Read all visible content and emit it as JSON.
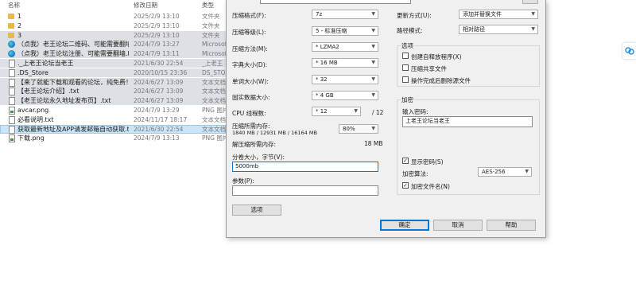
{
  "explorer": {
    "columns": {
      "name": "名称",
      "date": "修改日期",
      "type": "类型"
    },
    "files": [
      {
        "icon": "folder-icon",
        "name": "1",
        "date": "2025/2/9 13:10",
        "type": "文件夹"
      },
      {
        "icon": "folder-icon",
        "name": "2",
        "date": "2025/2/9 13:10",
        "type": "文件夹"
      },
      {
        "icon": "folder-icon",
        "name": "3",
        "date": "2025/2/9 13:10",
        "type": "文件夹"
      },
      {
        "icon": "edge-icon",
        "name": "（点我）老王论坛二维码、可能需要翻墙...",
        "date": "2024/7/9 13:27",
        "type": "Microsoft"
      },
      {
        "icon": "edge-icon",
        "name": "（点我）老王论坛注册、可能需要翻墙.h...",
        "date": "2024/7/9 13:11",
        "type": "Microsoft"
      },
      {
        "icon": "doc-icon",
        "name": "._上老王论坛当老王",
        "date": "2021/6/30 22:54",
        "type": "_上老王"
      },
      {
        "icon": "doc-icon",
        "name": ".DS_Store",
        "date": "2020/10/15 23:36",
        "type": "DS_STOR"
      },
      {
        "icon": "doc-icon",
        "name": "【来了就能下载和观看的论坛，纯免费！...",
        "date": "2024/6/27 13:09",
        "type": "文本文档"
      },
      {
        "icon": "doc-icon",
        "name": "【老王论坛介绍】.txt",
        "date": "2024/6/27 13:09",
        "type": "文本文档"
      },
      {
        "icon": "doc-icon",
        "name": "【老王论坛永久地址发布页】.txt",
        "date": "2024/6/27 13:09",
        "type": "文本文档"
      },
      {
        "icon": "png-icon",
        "name": "avcar.png",
        "date": "2024/7/9 13:29",
        "type": "PNG 图片"
      },
      {
        "icon": "doc-icon",
        "name": "必看说明.txt",
        "date": "2024/11/17 18:17",
        "type": "文本文档"
      },
      {
        "icon": "doc-icon",
        "name": "获取最新地址及APP请发邮箱自动获取.txt",
        "date": "2021/6/30 22:54",
        "type": "文本文档"
      },
      {
        "icon": "png-icon",
        "name": "下载.png",
        "date": "2024/7/9 13:13",
        "type": "PNG 图片"
      }
    ]
  },
  "dialog": {
    "labels": {
      "format": "压缩格式(F):",
      "level": "压缩等级(L):",
      "method": "压缩方法(M):",
      "dict": "字典大小(D):",
      "word": "单词大小(W):",
      "block": "固实数据大小:",
      "cpu": "CPU 线程数:",
      "mem_compress": "压缩所需内存:",
      "mem_detail": "1840 MB / 12931 MB / 16164 MB",
      "mem_decompress": "解压缩所需内存:",
      "mem_decompress_value": "18 MB",
      "split": "分卷大小，字节(V):",
      "params": "参数(P):",
      "update": "更新方式(U):",
      "path": "路径模式:",
      "options": "选项",
      "encrypt": "加密",
      "password": "输入密码:",
      "enc_method": "加密算法:"
    },
    "values": {
      "format": "7z",
      "level": "5 - 标准压缩",
      "method": "* LZMA2",
      "dict": "* 16 MB",
      "word": "* 32",
      "block": "* 4 GB",
      "cpu": "* 12",
      "cpu_total": "/ 12",
      "mem_percent": "80%",
      "split": "5000mb",
      "params": "",
      "update": "添加并替换文件",
      "path": "相对路径",
      "password": "上老王论坛当老王",
      "enc_method": "AES-256"
    },
    "options": [
      {
        "label": "创建自释放程序(X)",
        "checked": false
      },
      {
        "label": "压缩共享文件",
        "checked": false
      },
      {
        "label": "操作完成后删除源文件",
        "checked": false
      }
    ],
    "show_password": {
      "label": "显示密码(S)",
      "checked": true
    },
    "encrypt_names": {
      "label": "加密文件名(N)",
      "checked": true
    },
    "buttons": {
      "options": "选项",
      "ok": "确定",
      "cancel": "取消",
      "help": "帮助"
    }
  },
  "colors": {
    "selected_row": "#dde0e4",
    "highlight_row": "#cce4f7",
    "accent": "#0078d7",
    "dialog_bg": "#f0f0f0"
  }
}
